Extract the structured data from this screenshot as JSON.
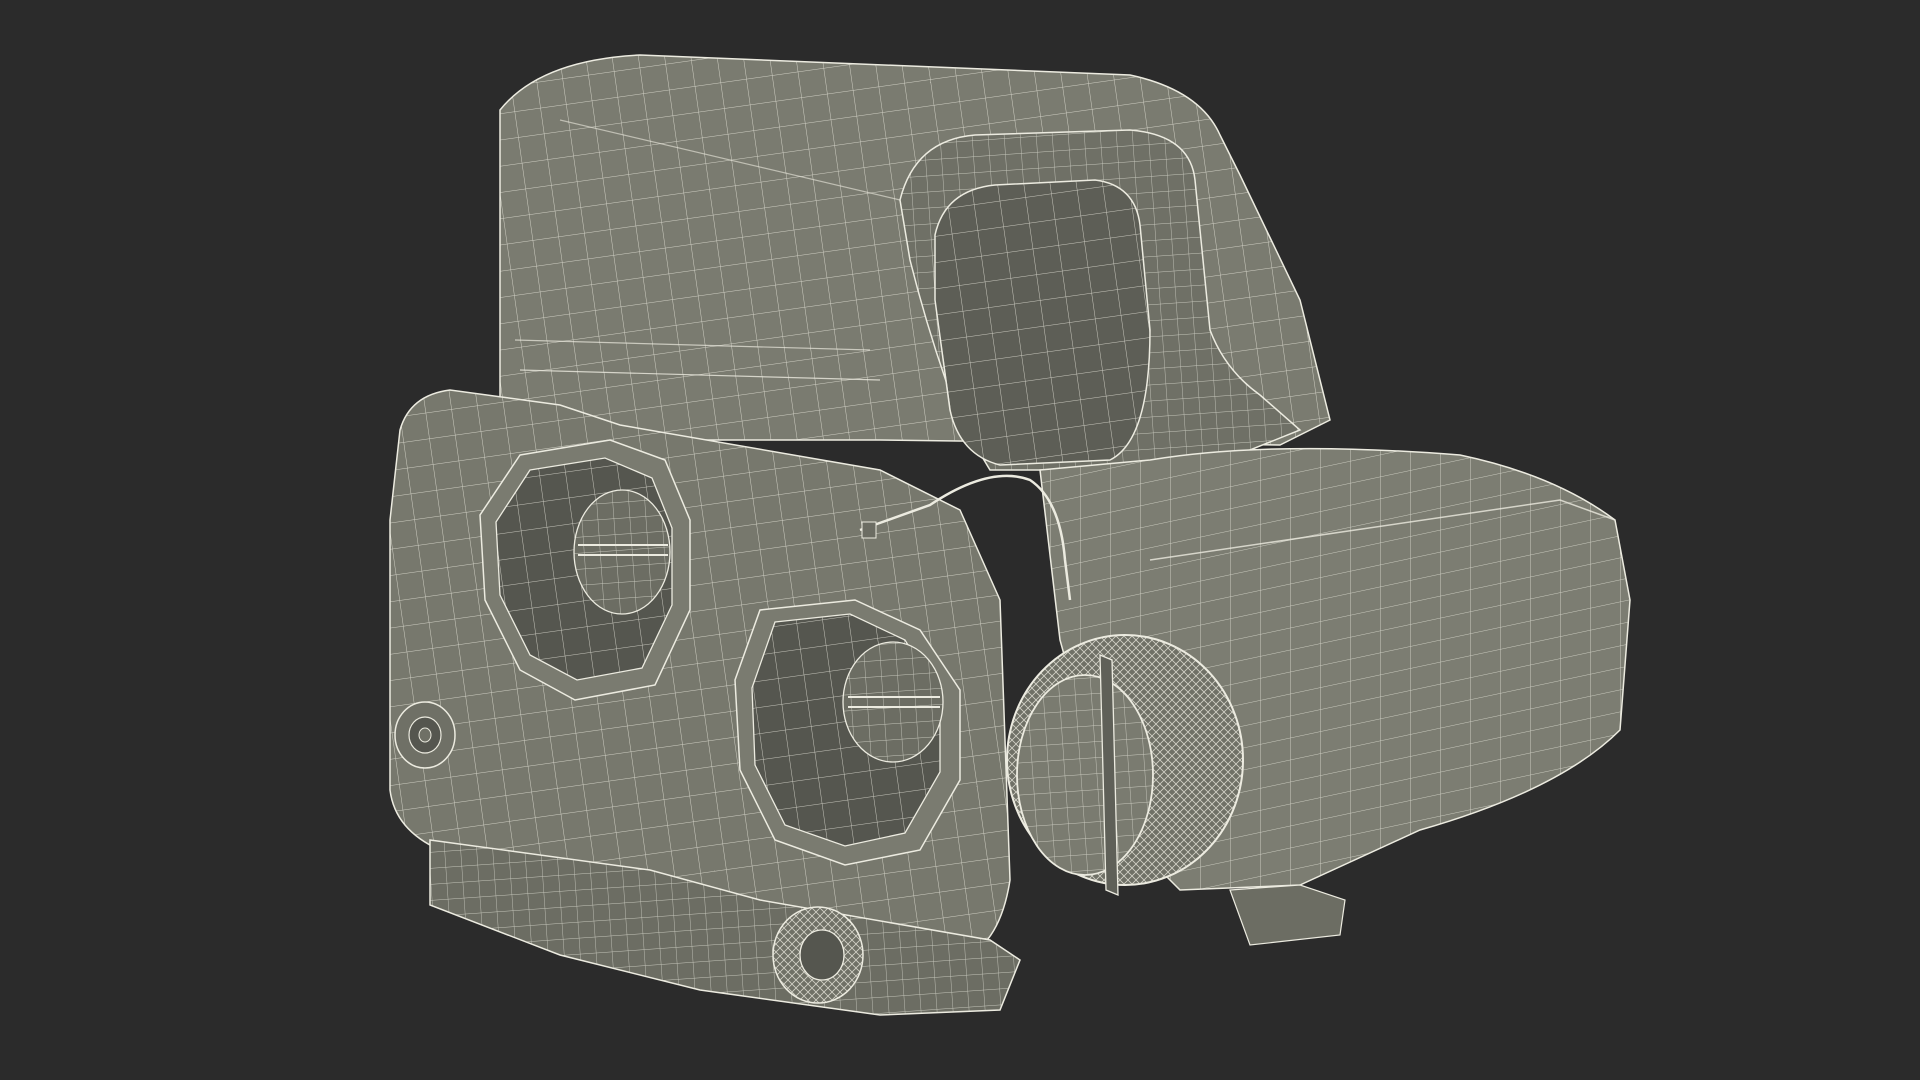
{
  "scene": {
    "subject_icon": "holographic-sight-model-icon",
    "render_style": "wireframe-on-shaded",
    "colors": {
      "background": "#2b2b2b",
      "body_fill": "#7a7b70",
      "body_shadow": "#5f6058",
      "body_light": "#8d8e82",
      "inner_dark": "#4f504a",
      "wire": "#ecebe0"
    }
  }
}
